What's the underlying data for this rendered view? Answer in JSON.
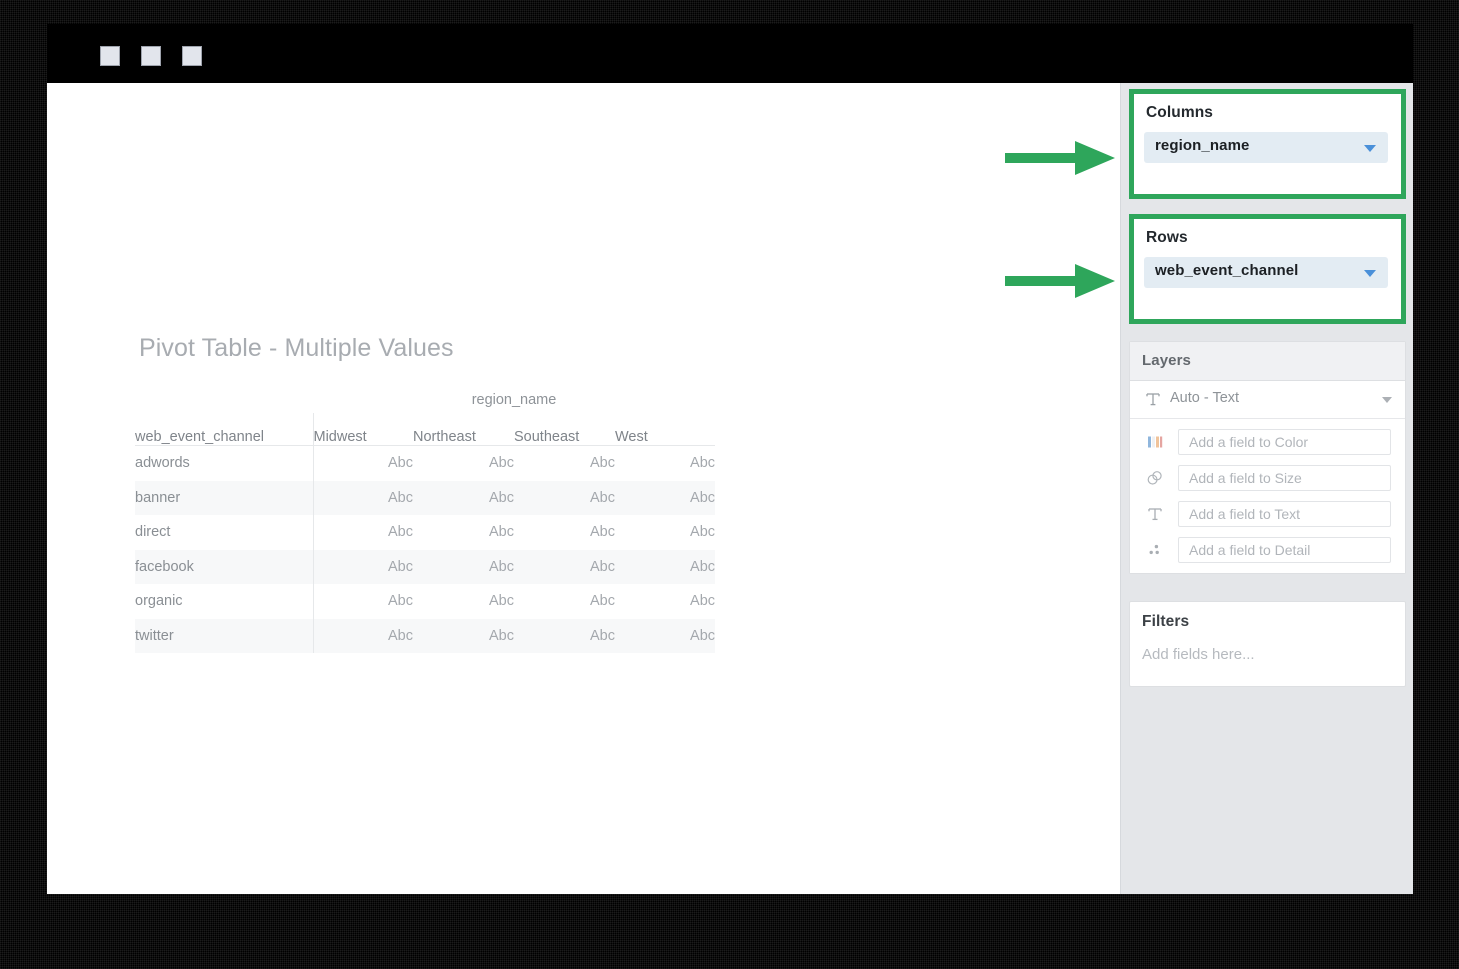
{
  "window": {
    "titlebar_buttons": [
      "window-button-1",
      "window-button-2",
      "window-button-3"
    ]
  },
  "canvas": {
    "title": "Pivot Table - Multiple Values"
  },
  "pivot_table": {
    "column_field_label": "region_name",
    "row_field_label": "web_event_channel",
    "column_headers": [
      "Midwest",
      "Northeast",
      "Southeast",
      "West"
    ],
    "rows": [
      {
        "label": "adwords",
        "values": [
          "Abc",
          "Abc",
          "Abc",
          "Abc"
        ]
      },
      {
        "label": "banner",
        "values": [
          "Abc",
          "Abc",
          "Abc",
          "Abc"
        ]
      },
      {
        "label": "direct",
        "values": [
          "Abc",
          "Abc",
          "Abc",
          "Abc"
        ]
      },
      {
        "label": "facebook",
        "values": [
          "Abc",
          "Abc",
          "Abc",
          "Abc"
        ]
      },
      {
        "label": "organic",
        "values": [
          "Abc",
          "Abc",
          "Abc",
          "Abc"
        ]
      },
      {
        "label": "twitter",
        "values": [
          "Abc",
          "Abc",
          "Abc",
          "Abc"
        ]
      }
    ]
  },
  "sidebar": {
    "columns_shelf": {
      "title": "Columns",
      "pill_label": "region_name",
      "caret_icon": "chevron-down-icon"
    },
    "rows_shelf": {
      "title": "Rows",
      "pill_label": "web_event_channel",
      "caret_icon": "chevron-down-icon"
    },
    "layers": {
      "header": "Layers",
      "layer_type_label": "Auto - Text",
      "layer_type_icon": "text-T-icon",
      "encodings": [
        {
          "icon": "color-palette-icon",
          "placeholder": "Add a field to Color"
        },
        {
          "icon": "size-circles-icon",
          "placeholder": "Add a field to Size"
        },
        {
          "icon": "text-T-icon",
          "placeholder": "Add a field to Text"
        },
        {
          "icon": "detail-dots-icon",
          "placeholder": "Add a field to Detail"
        }
      ]
    },
    "filters": {
      "header": "Filters",
      "placeholder": "Add fields here..."
    }
  },
  "annotations": {
    "arrow_color": "#2ea65b",
    "highlight_color": "#2ea65b",
    "arrows": [
      {
        "name": "arrow-pointing-to-columns-shelf"
      },
      {
        "name": "arrow-pointing-to-rows-shelf"
      }
    ]
  },
  "colors": {
    "accent_green": "#2ea65b",
    "pill_background": "#e3ecf3",
    "pill_caret": "#4a90d9",
    "sidebar_background": "#e4e6e9",
    "table_alt_row": "#f7f8f9"
  }
}
